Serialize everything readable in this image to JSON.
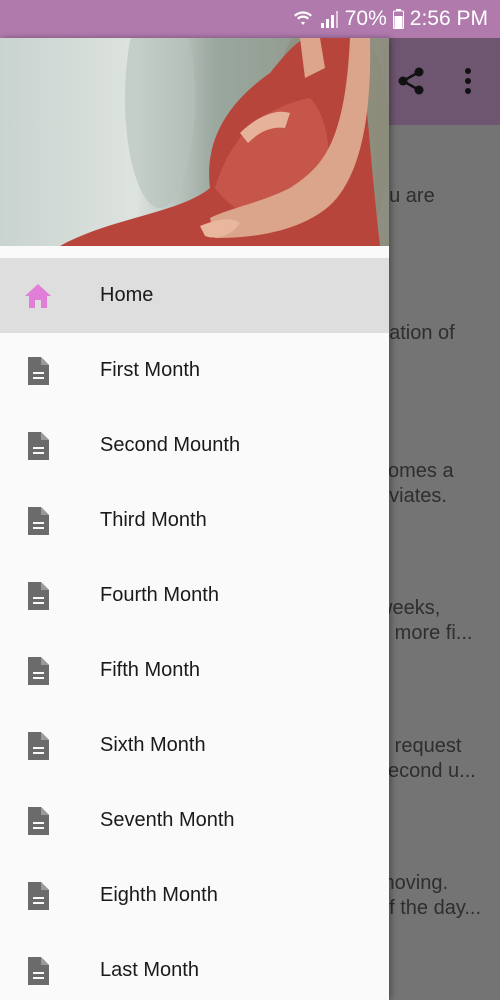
{
  "status_bar": {
    "battery": "70%",
    "time": "2:56 PM",
    "background_color": "#b07aad"
  },
  "toolbar": {
    "icons": [
      "share-icon",
      "more-vert-icon"
    ]
  },
  "background_content": {
    "lines": [
      "ou are",
      "nation of",
      "comes a",
      "eviates.",
      "weeks,",
      "d more fi...",
      "n request",
      "second u...",
      "moving.",
      "of the day..."
    ]
  },
  "drawer": {
    "accent_color": "#e07ed8",
    "icon_color": "#6b6b6b",
    "menu": [
      {
        "label": "Home",
        "icon": "home-icon",
        "active": true
      },
      {
        "label": "First Month",
        "icon": "document-icon"
      },
      {
        "label": "Second Mounth",
        "icon": "document-icon"
      },
      {
        "label": "Third Month",
        "icon": "document-icon"
      },
      {
        "label": "Fourth Month",
        "icon": "document-icon"
      },
      {
        "label": "Fifth Month",
        "icon": "document-icon"
      },
      {
        "label": "Sixth Month",
        "icon": "document-icon"
      },
      {
        "label": "Seventh Month",
        "icon": "document-icon"
      },
      {
        "label": "Eighth Month",
        "icon": "document-icon"
      },
      {
        "label": "Last Month",
        "icon": "document-icon"
      }
    ]
  }
}
